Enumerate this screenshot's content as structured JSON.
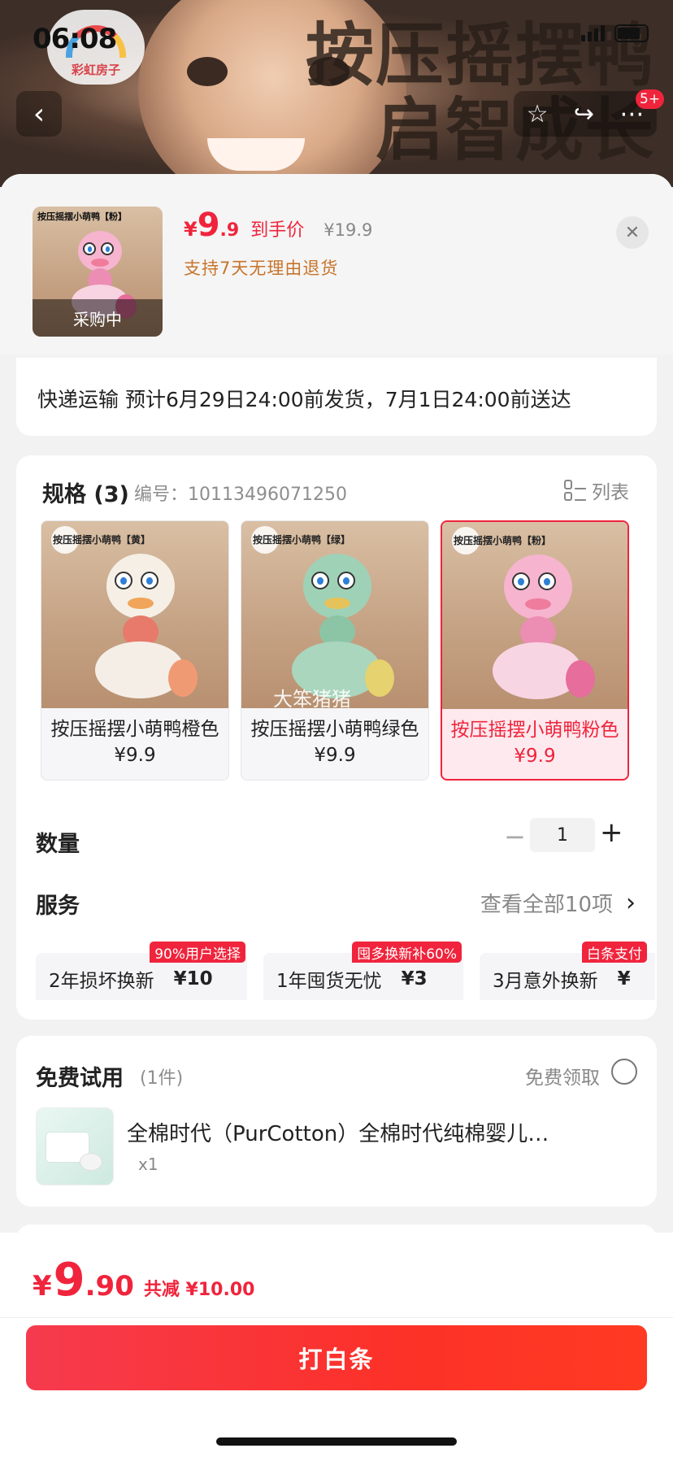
{
  "status_bar": {
    "time": "06:08"
  },
  "hero": {
    "title_line1": "按压摇摆鸭",
    "title_line2": "启智成长",
    "brand_name": "彩虹房子"
  },
  "nav": {
    "back_icon": "chevron-left-icon",
    "cart_badge": "5+"
  },
  "product": {
    "currency": "¥",
    "price_int": "9",
    "price_dec": ".9",
    "price_tag": "到手价",
    "original_price": "¥19.9",
    "return_policy": "支持7天无理由退货",
    "thumb_tag": "按压摇摆小萌鸭【粉】",
    "thumb_status": "采购中"
  },
  "shipping": {
    "text": "快递运输 预计6月29日24:00前发货，7月1日24:00前送达"
  },
  "spec": {
    "title": "规格 (3)",
    "code": "编号：10113496071250",
    "list_label": "列表",
    "options": [
      {
        "tag": "按压摇摆小萌鸭【黄】",
        "name": "按压摇摆小萌鸭橙色 ¥9.9",
        "selected": false,
        "color": "#f6efe4"
      },
      {
        "tag": "按压摇摆小萌鸭【绿】",
        "name": "按压摇摆小萌鸭绿色 ¥9.9",
        "selected": false,
        "color": "#9fd1b7"
      },
      {
        "tag": "按压摇摆小萌鸭【粉】",
        "name": "按压摇摆小萌鸭粉色 ¥9.9",
        "selected": true,
        "color": "#f6b4cf"
      }
    ],
    "watermark": "大笨猪猪"
  },
  "quantity": {
    "label": "数量",
    "minus": "−",
    "value": "1",
    "plus": "+"
  },
  "services": {
    "label": "服务",
    "view_all": "查看全部10项",
    "items": [
      {
        "name": "2年损坏换新",
        "price": "¥10",
        "badge": "90%用户选择"
      },
      {
        "name": "1年囤货无忧",
        "price": "¥3",
        "badge": "囤多换新补60%"
      },
      {
        "name": "3月意外换新",
        "price": "¥",
        "badge": "白条支付"
      }
    ]
  },
  "trial": {
    "title": "免费试用",
    "count": "(1件)",
    "claim_label": "免费领取",
    "item_name": "全棉时代（PurCotton）全棉时代纯棉婴儿…",
    "item_qty": "x1"
  },
  "footer": {
    "currency": "¥",
    "total_int": "9",
    "total_dec": ".90",
    "discount": "共减 ¥10.00",
    "pay_button": "打白条"
  },
  "colors": {
    "accent": "#f0243c",
    "orange_note": "#c8742b"
  }
}
